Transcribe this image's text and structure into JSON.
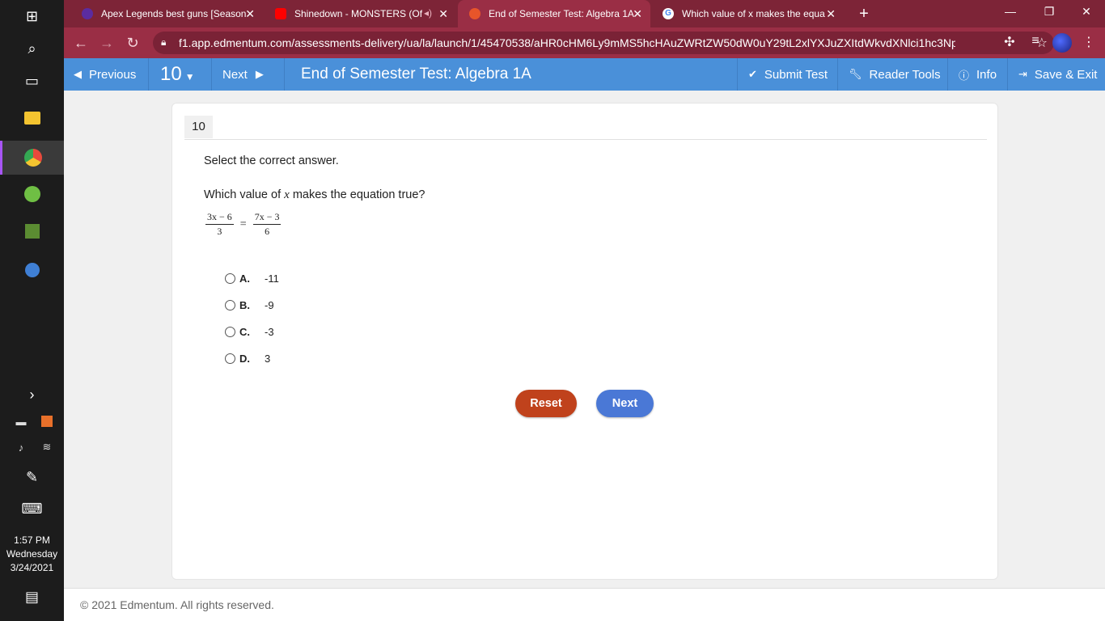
{
  "taskbar": {
    "time": "1:57 PM",
    "day": "Wednesday",
    "date": "3/24/2021"
  },
  "tabs": [
    {
      "title": "Apex Legends best guns [Season",
      "favicon_color": "#5b2ca0",
      "active": false
    },
    {
      "title": "Shinedown - MONSTERS (Of",
      "favicon_color": "#ff0000",
      "active": false
    },
    {
      "title": "End of Semester Test: Algebra 1A",
      "favicon_color": "#e8552a",
      "active": true
    },
    {
      "title": "Which value of x makes the equa",
      "favicon_color": "#ffffff",
      "active": false
    }
  ],
  "browser": {
    "url": "f1.app.edmentum.com/assessments-delivery/ua/la/launch/1/45470538/aHR0cHM6Ly9mMS5hcHAuZWRtZW50dW0uY29tL2xlYXJuZXItdWkvdXNlci1hc3Np...",
    "accent": "#9a2e45"
  },
  "appbar": {
    "previous_label": "Previous",
    "question_selector": "10",
    "next_label": "Next",
    "title": "End of Semester Test: Algebra 1A",
    "submit_label": "Submit Test",
    "reader_tools_label": "Reader Tools",
    "info_label": "Info",
    "save_exit_label": "Save & Exit",
    "color": "#4a90d9"
  },
  "question": {
    "number": "10",
    "instruction": "Select the correct answer.",
    "prompt_before": "Which value of ",
    "prompt_var": "x",
    "prompt_after": " makes the equation true?",
    "equation": {
      "left_num": "3x − 6",
      "left_den": "3",
      "equals": "=",
      "right_num": "7x − 3",
      "right_den": "6"
    },
    "choices": [
      {
        "letter": "A.",
        "value": "-11"
      },
      {
        "letter": "B.",
        "value": "-9"
      },
      {
        "letter": "C.",
        "value": "-3"
      },
      {
        "letter": "D.",
        "value": "3"
      }
    ]
  },
  "buttons": {
    "reset_label": "Reset",
    "next_label": "Next",
    "reset_color": "#c0421c",
    "next_color": "#4a78d6"
  },
  "footer": {
    "text": "© 2021 Edmentum. All rights reserved."
  }
}
